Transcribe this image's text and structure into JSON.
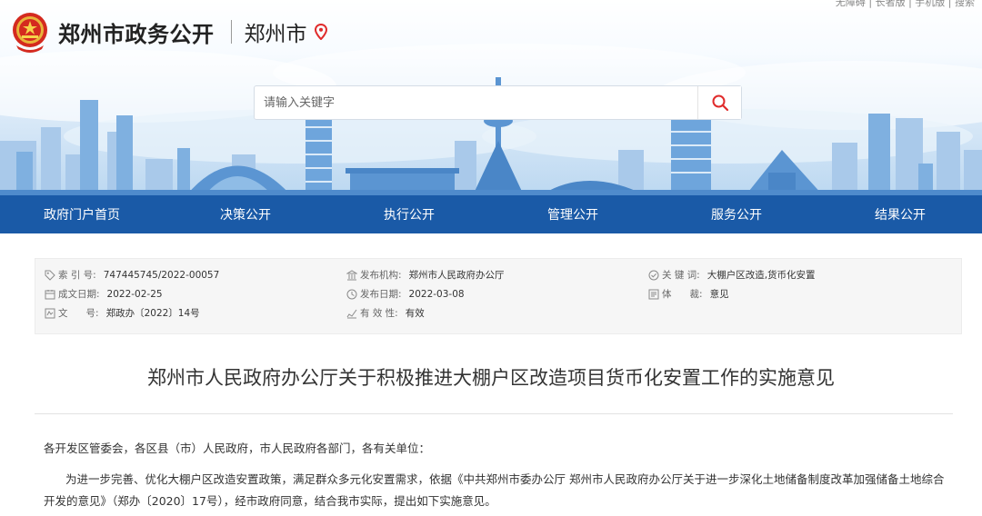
{
  "header": {
    "site_title": "郑州市政务公开",
    "city": "郑州市",
    "top_links": "无障碍 | 长者版 | 手机版 | 搜索"
  },
  "search": {
    "placeholder": "请输入关键字"
  },
  "nav": [
    {
      "label": "政府门户首页"
    },
    {
      "label": "决策公开"
    },
    {
      "label": "执行公开"
    },
    {
      "label": "管理公开"
    },
    {
      "label": "服务公开"
    },
    {
      "label": "结果公开"
    }
  ],
  "info": {
    "index_label": "索 引 号:",
    "index_value": "747445745/2022-00057",
    "publisher_label": "发布机构:",
    "publisher_value": "郑州市人民政府办公厅",
    "keywords_label": "关 键 词:",
    "keywords_value": "大棚户区改造,货币化安置",
    "created_label": "成文日期:",
    "created_value": "2022-02-25",
    "published_label": "发布日期:",
    "published_value": "2022-03-08",
    "genre_label": "体      裁:",
    "genre_value": "意见",
    "docno_label": "文      号:",
    "docno_value": "郑政办〔2022〕14号",
    "validity_label": "有 效 性:",
    "validity_value": "有效"
  },
  "article": {
    "title": "郑州市人民政府办公厅关于积极推进大棚户区改造项目货币化安置工作的实施意见",
    "salutation": "各开发区管委会，各区县（市）人民政府，市人民政府各部门，各有关单位：",
    "paragraph1": "为进一步完善、优化大棚户区改造安置政策，满足群众多元化安置需求，依据《中共郑州市委办公厅 郑州市人民政府办公厅关于进一步深化土地储备制度改革加强储备土地综合开发的意见》（郑办〔2020〕17号），经市政府同意，结合我市实际，提出如下实施意见。"
  },
  "colors": {
    "nav_bg": "#1a5aa7",
    "accent_red": "#e02b2b",
    "info_bg": "#f6f6f6"
  },
  "icons": [
    "emblem-icon",
    "location-pin-icon",
    "search-icon",
    "tag-icon",
    "building-icon",
    "check-circle-icon",
    "calendar-icon",
    "clock-icon",
    "genre-icon",
    "document-icon",
    "validity-icon"
  ]
}
